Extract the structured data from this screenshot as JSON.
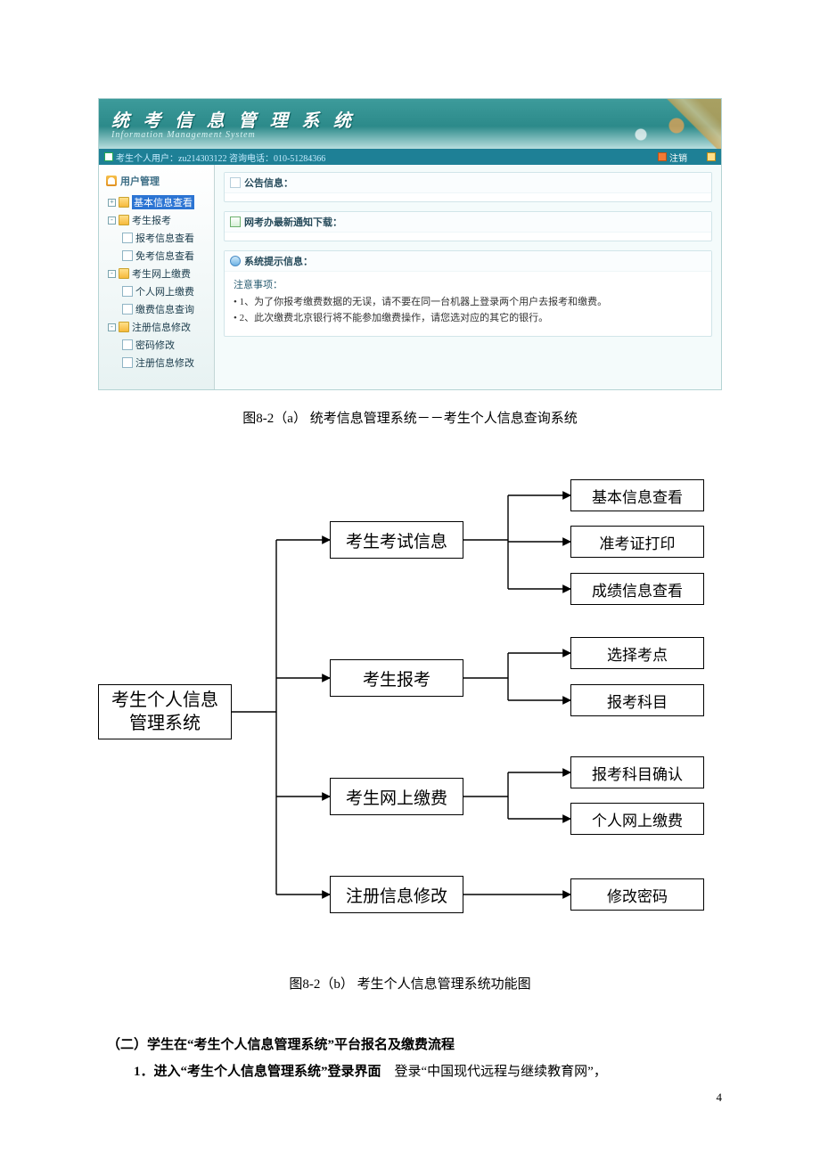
{
  "app": {
    "banner_zh": "统 考 信 息 管 理 系 统",
    "banner_en": "Information  Management  System",
    "topbar_left": "考生个人用户：zu214303122 咨询电话：010-51284366",
    "logout": "注销"
  },
  "sidebar": {
    "title": "用户管理",
    "nodes": [
      {
        "type": "root-sel",
        "label": "基本信息查看"
      },
      {
        "type": "root",
        "label": "考生报考"
      },
      {
        "type": "child",
        "label": "报考信息查看"
      },
      {
        "type": "child",
        "label": "免考信息查看"
      },
      {
        "type": "root",
        "label": "考生网上缴费"
      },
      {
        "type": "child",
        "label": "个人网上缴费"
      },
      {
        "type": "child",
        "label": "缴费信息查询"
      },
      {
        "type": "root",
        "label": "注册信息修改"
      },
      {
        "type": "child",
        "label": "密码修改"
      },
      {
        "type": "child",
        "label": "注册信息修改"
      }
    ]
  },
  "panels": {
    "p1_title": "公告信息：",
    "p2_title": "网考办最新通知下载：",
    "p3_title": "系统提示信息：",
    "p3_body_head": "注意事项：",
    "p3_body_1": "• 1、为了你报考缴费数据的无误，请不要在同一台机器上登录两个用户去报考和缴费。",
    "p3_body_2": "• 2、此次缴费北京银行将不能参加缴费操作，请您选对应的其它的银行。"
  },
  "caption_a": "图8-2（a） 统考信息管理系统－－考生个人信息查询系统",
  "caption_b": "图8-2（b） 考生个人信息管理系统功能图",
  "chart_data": {
    "type": "tree",
    "root": "考生个人信息\n管理系统",
    "mids": [
      "考生考试信息",
      "考生报考",
      "考生网上缴费",
      "注册信息修改"
    ],
    "leaves": {
      "0": [
        "基本信息查看",
        "准考证打印",
        "成绩信息查看"
      ],
      "1": [
        "选择考点",
        "报考科目"
      ],
      "2": [
        "报考科目确认",
        "个人网上缴费"
      ],
      "3": [
        "修改密码"
      ]
    }
  },
  "doc": {
    "section_head": "（二）学生在“考生个人信息管理系统”平台报名及缴费流程",
    "step1_bold": "1．进入“考生个人信息管理系统”登录界面",
    "step1_rest": "　登录“中国现代远程与继续教育网”，"
  },
  "page_number": "4"
}
